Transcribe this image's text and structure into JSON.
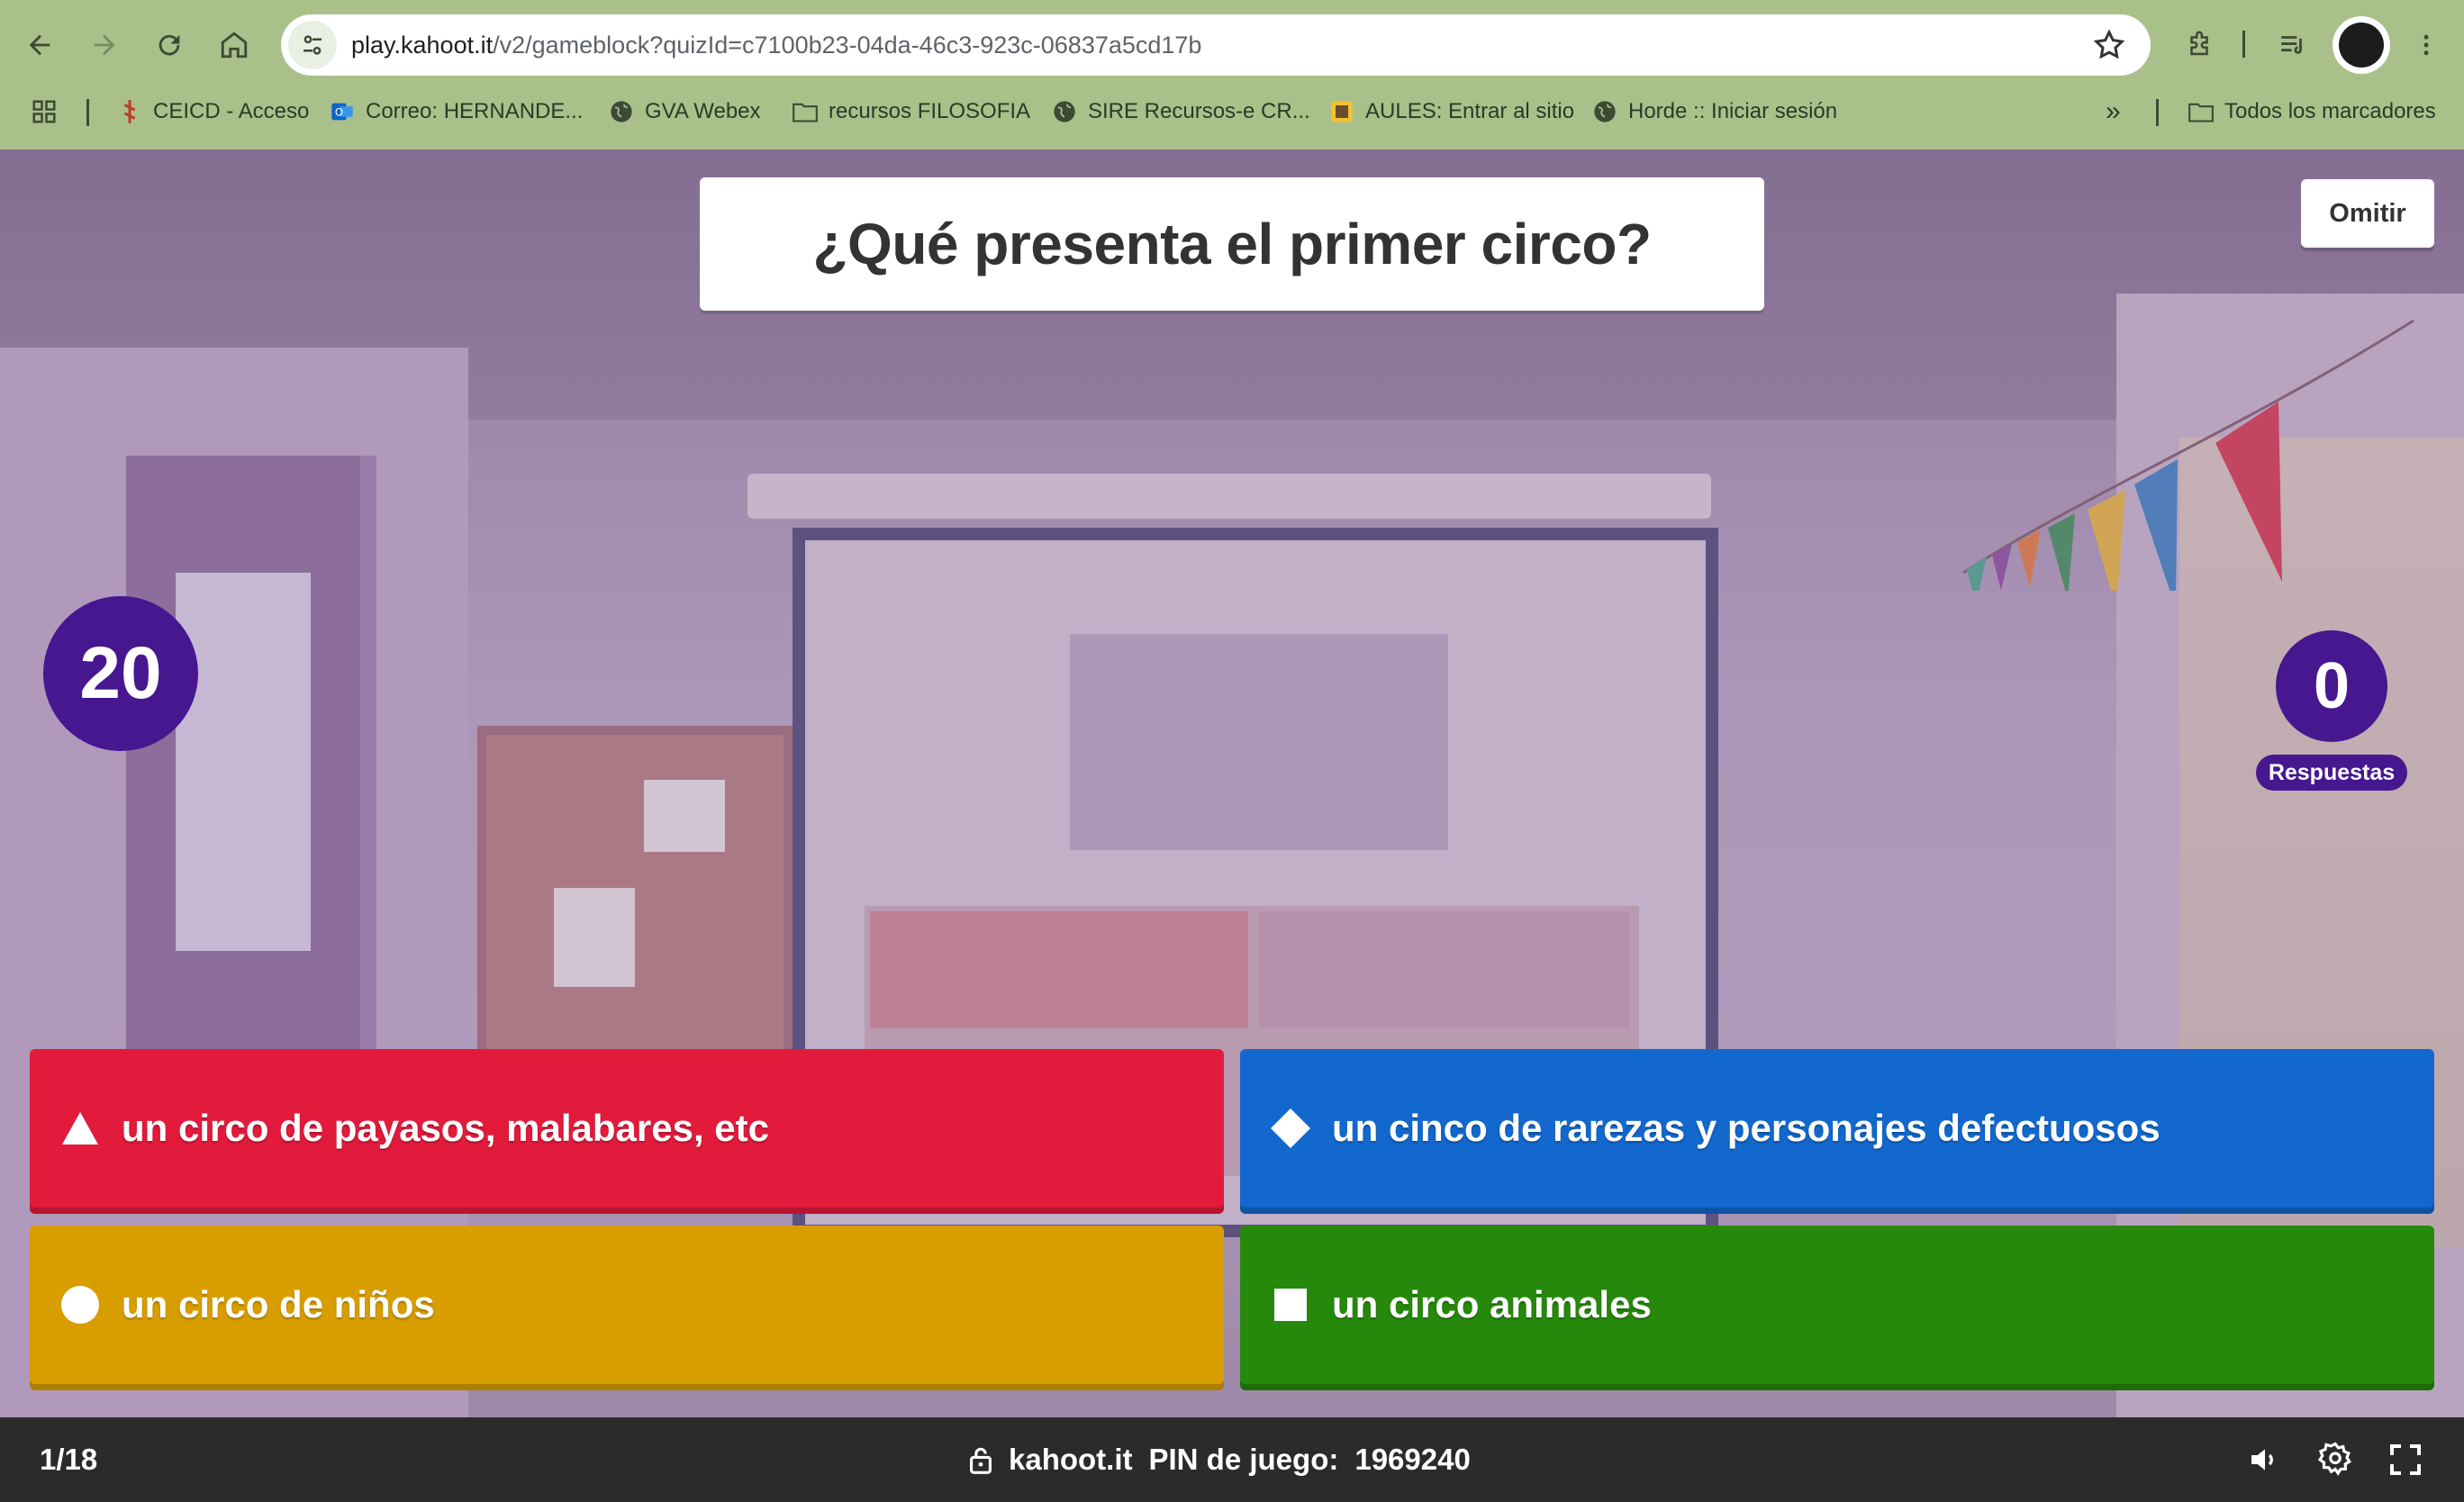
{
  "browser": {
    "url_host": "play.kahoot.it",
    "url_path": "/v2/gameblock?quizId=c7100b23-04da-46c3-923c-06837a5cd17b",
    "icons": [
      "back-icon",
      "forward-icon",
      "reload-icon",
      "home-icon",
      "site-info-icon",
      "bookmark-star-icon",
      "extensions-icon",
      "media-icon",
      "profile-avatar",
      "menu-icon"
    ],
    "bookmarks": [
      {
        "label": "CEICD - Acceso",
        "icon": "bookmark-site-icon"
      },
      {
        "label": "Correo: HERNANDE...",
        "icon": "outlook-icon"
      },
      {
        "label": "GVA Webex",
        "icon": "globe-icon"
      },
      {
        "label": "recursos FILOSOFIA",
        "icon": "folder-icon"
      },
      {
        "label": "SIRE Recursos-e CR...",
        "icon": "globe-icon"
      },
      {
        "label": "AULES: Entrar al sitio",
        "icon": "aules-icon"
      },
      {
        "label": "Horde :: Iniciar sesión",
        "icon": "globe-icon"
      }
    ],
    "more_bookmarks": "»",
    "all_bookmarks": "Todos los marcadores"
  },
  "game": {
    "question": "¿Qué presenta el primer circo?",
    "skip_label": "Omitir",
    "timer": "20",
    "answers_count": "0",
    "answers_label": "Respuestas",
    "answers": [
      {
        "shape": "triangle",
        "color": "#e21b3c",
        "label": "un circo de payasos, malabares, etc"
      },
      {
        "shape": "diamond",
        "color": "#1368ce",
        "label": "un cinco de rarezas y personajes defectuosos"
      },
      {
        "shape": "circle",
        "color": "#d89e00",
        "label": "un circo de niños"
      },
      {
        "shape": "square",
        "color": "#26890c",
        "label": "un circo animales"
      }
    ]
  },
  "bottom_bar": {
    "progress": "1/18",
    "site": "kahoot.it",
    "pin_label": "PIN de juego:",
    "pin": "1969240"
  },
  "colors": {
    "kahoot_purple": "#46178f",
    "chrome_theme": "#a9c08b"
  }
}
